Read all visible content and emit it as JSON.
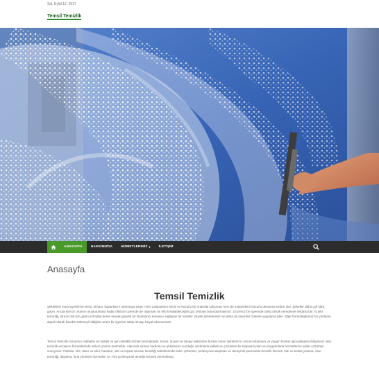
{
  "header": {
    "date": "Sal, Eylül 12, 2017",
    "logo_text": "Temsil Temizlik"
  },
  "hero": {
    "image_name": "window-cleaning-squeegee-photo",
    "colors": {
      "sky": "#3a66b8",
      "foam": "#f4f6fb",
      "frame": "#8a8f99"
    }
  },
  "nav": {
    "home_icon": "home-icon",
    "items": [
      {
        "label": "ANASAYFA"
      },
      {
        "label": "HAKKIMIZDA"
      },
      {
        "label": "HİZMETLERİMİZ"
      },
      {
        "label": "İLETİŞİM"
      }
    ],
    "search_icon": "search-icon",
    "colors": {
      "bar": "#2c2c2c",
      "active": "#4a9a2a"
    }
  },
  "page": {
    "title": "Anasayfa",
    "heading": "Temsil Temizlik",
    "paragraph1": "Şirketlerin veya işyerlerinin temiz olması, başarılarını arttırmaya yarar. Hem çalışanların temiz ve huzurlu bir ortamda çalışması hem de müşterilerin huzurlu olmasına neden olur. Şirketler daha çok kâra geçer. Ancak kirli bir ortamın oluşturulması kadar ofisinizi üzerinde de oluşması bir etki bırakabileceğini göz önünde bulundurmalısınız. Düzenoz bir işyerinde rahat olmak neredeyse imkânsızdır. İş yeri temizliği, titreze dolu bir gürün sırfından demir aracak güvenli bir limanlarını temasını sağlayan bir sanattır. Büyük şirketlerimizi ve daha da önemlisi özlemle uygulama işleri. Eğer formülleşilirimiz bir yönteme dayalı olarak hareket ettirmeyi bildiğiniz temiz bir işyerine sahip olmayı hayal edemezsiniz.",
    "paragraph2": "Temsil Temizlik mmumun maliyette en kaliteli ve ayrı-nitelikli hizmeti sunmaktadır. Konut, ticaret ve sanayi sektörüne hizmet veren şirketimizin uzman ekipmanı ve yaygın hizmet ağı yaklaşma ihtiyacınız olan temizlik ve bakım hizmetlerinde sizlere çözüm üretmekte. Alanında uzman kadrosu ve şirketinizin sunduğu imkânlarla kaliteli ve çözümleri bir kapsamlı plan ve programlarla hizmetlerine kadar çözümler sunuyoruz. Fabrika, ofis, daire ve okul, hastane, otel ve inşaat sonrası temizliği sektörlerinde kalıcı çözümler, profesyonel ekipman ve deneyimli personelle temizlik hizmeti, halı ve koltuk yıkama, cam temizliği, ilaçlama, bina yönetimi hizmetleri ve 7/24 profesyonel temizlik hizmeti vermekteyiz."
  }
}
